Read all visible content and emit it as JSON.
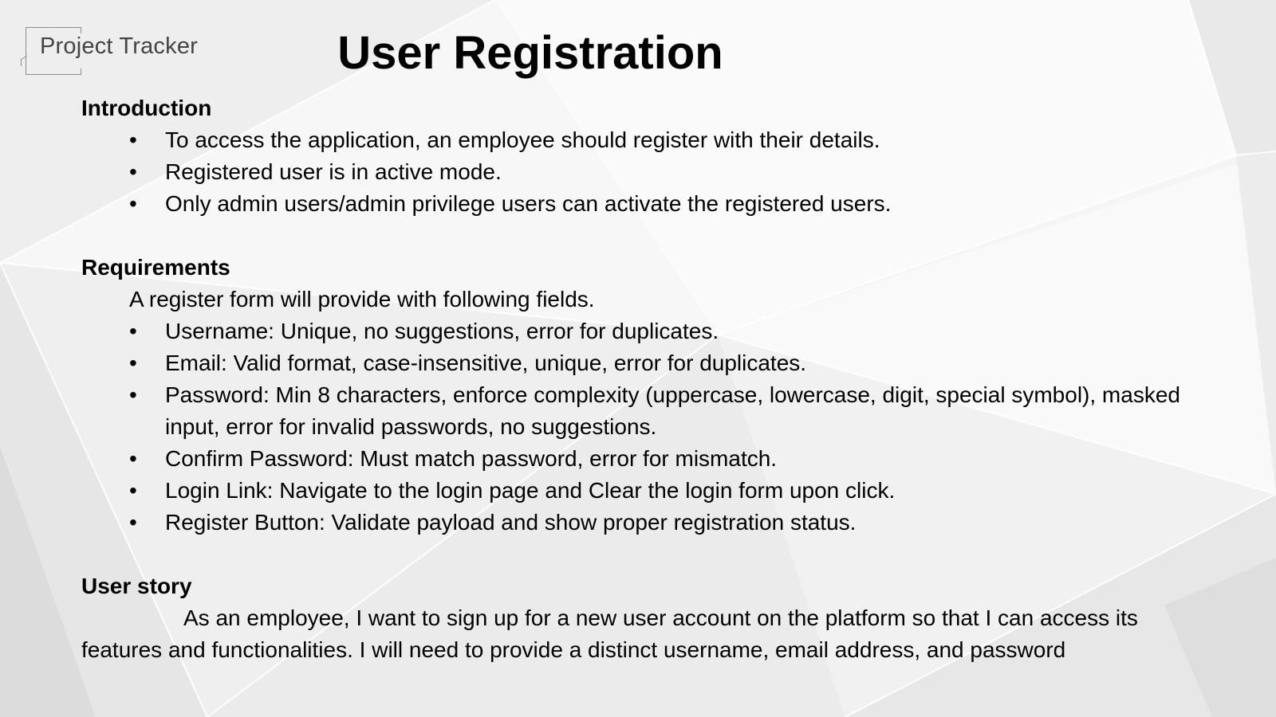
{
  "brand": {
    "name": "Project Tracker"
  },
  "title": "User Registration",
  "sections": {
    "introduction": {
      "heading": "Introduction",
      "bullets": [
        "To access the application, an employee should register with their details.",
        "Registered user is in active mode.",
        "Only admin users/admin privilege users can activate the registered users."
      ]
    },
    "requirements": {
      "heading": "Requirements",
      "intro": "A register form will provide with following fields.",
      "bullets": [
        "Username: Unique, no suggestions, error for duplicates.",
        "Email: Valid format, case-insensitive, unique, error for duplicates.",
        "Password: Min 8 characters, enforce complexity (uppercase, lowercase, digit, special symbol), masked input, error for invalid passwords, no suggestions.",
        "Confirm Password: Must match password, error for mismatch.",
        "Login Link: Navigate to the login page and Clear the login form upon click.",
        "Register Button: Validate payload and show proper registration status."
      ]
    },
    "user_story": {
      "heading": "User story",
      "text": "As an employee, I want to sign up for a new user account on the platform so that I can access its features and functionalities. I will need to provide a distinct username, email address, and password"
    }
  },
  "bullet_glyph": "•",
  "colors": {
    "background": "#f4f4f4",
    "text": "#000000",
    "logo_text": "#444444"
  }
}
